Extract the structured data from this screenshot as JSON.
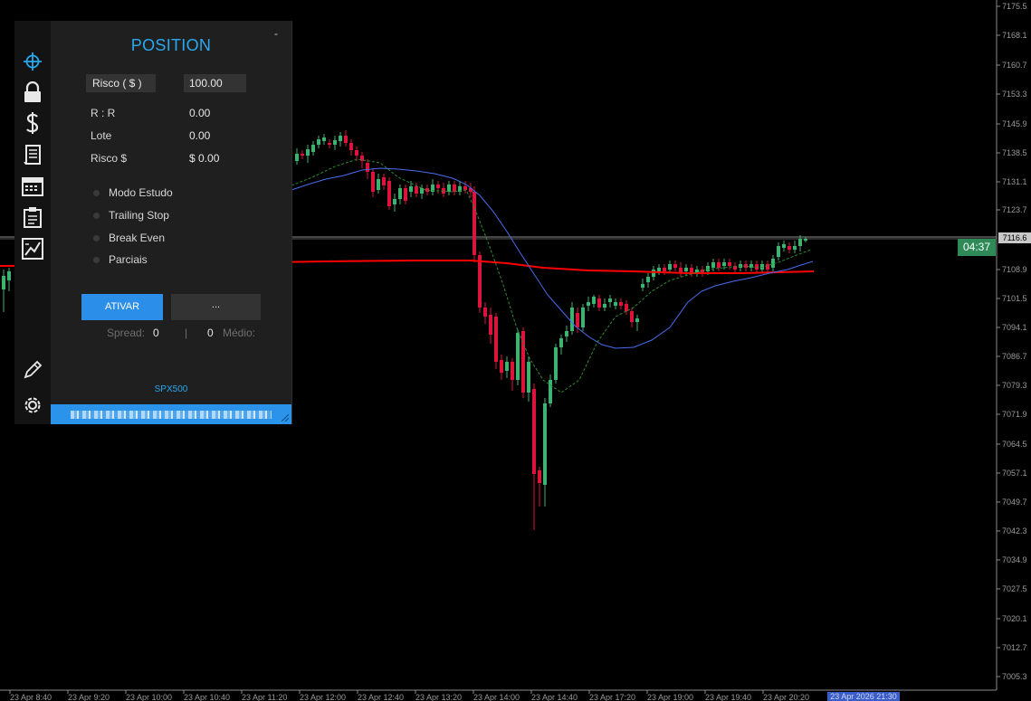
{
  "panel": {
    "title": "POSITION",
    "minimize_label": "-",
    "risk_button_label": "Risco ( $ )",
    "risk_input_value": "100.00",
    "rows": [
      {
        "label": "R : R",
        "value": "0.00"
      },
      {
        "label": "Lote",
        "value": "0.00"
      },
      {
        "label": "Risco $",
        "value": "$ 0.00"
      }
    ],
    "options": [
      {
        "label": "Modo Estudo",
        "checked": false
      },
      {
        "label": "Trailing Stop",
        "checked": false
      },
      {
        "label": "Break Even",
        "checked": false
      },
      {
        "label": "Parciais",
        "checked": false
      }
    ],
    "activate_label": "ATIVAR",
    "more_label": "...",
    "spread_label": "Spread:",
    "spread_value": "0",
    "separator": "|",
    "medio_label": "Médio:",
    "medio_value": "0",
    "symbol": "SPX500"
  },
  "toolbar": {
    "icons": [
      "crosshair-icon",
      "lock-icon",
      "dollar-icon",
      "receipt-icon",
      "calendar-icon",
      "clipboard-icon",
      "chart-icon",
      "pencil-icon",
      "gear-icon"
    ]
  },
  "chart": {
    "timer": "04:37",
    "current_price": "7116.6",
    "price_levels": [
      "7175.5",
      "7168.1",
      "7160.7",
      "7153.3",
      "7145.9",
      "7138.5",
      "7131.1",
      "7123.7",
      "7108.9",
      "7101.5",
      "7094.1",
      "7086.7",
      "7079.3",
      "7071.9",
      "7064.5",
      "7057.1",
      "7049.7",
      "7042.3",
      "7034.9",
      "7027.5",
      "7020.1",
      "7012.7",
      "7005.3"
    ],
    "time_labels": [
      "23 Apr 8:40",
      "23 Apr 9:20",
      "23 Apr 10:00",
      "23 Apr 10:40",
      "23 Apr 11:20",
      "23 Apr 12:00",
      "23 Apr 12:40",
      "23 Apr 13:20",
      "23 Apr 14:00",
      "23 Apr 14:40",
      "23 Apr 17:20",
      "23 Apr 19:00",
      "23 Apr 19:40",
      "23 Apr 20:20"
    ],
    "current_date": "23 Apr 2026 21:30",
    "colors": {
      "bull": "#3cb371",
      "bear": "#dc143c",
      "ma_slow": "#ff0000",
      "ma_mid": "#4a6cf0",
      "ma_fast": "#2e8b2e"
    }
  }
}
